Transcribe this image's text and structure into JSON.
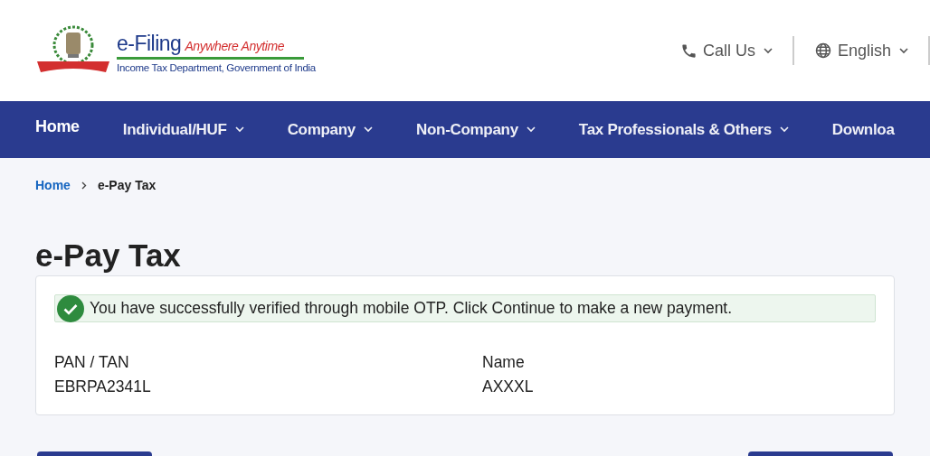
{
  "header": {
    "logo": {
      "brand": "e-Filing",
      "tagline": "Anywhere Anytime",
      "subtitle": "Income Tax Department, Government of India"
    },
    "actions": [
      {
        "kind": "phone",
        "label": "Call Us"
      },
      {
        "kind": "globe",
        "label": "English"
      }
    ]
  },
  "nav": [
    {
      "label": "Home",
      "selected": true,
      "dropdown": false
    },
    {
      "label": "Individual/HUF",
      "selected": false,
      "dropdown": true
    },
    {
      "label": "Company",
      "selected": false,
      "dropdown": true
    },
    {
      "label": "Non-Company",
      "selected": false,
      "dropdown": true
    },
    {
      "label": "Tax Professionals & Others",
      "selected": false,
      "dropdown": true
    },
    {
      "label": "Downloa",
      "selected": false,
      "dropdown": false
    }
  ],
  "breadcrumb": [
    {
      "label": "Home",
      "link": true
    },
    {
      "label": "e-Pay Tax",
      "link": false
    }
  ],
  "page_title": "e-Pay Tax",
  "alert": {
    "kind": "success",
    "message": "You have successfully verified through mobile OTP. Click Continue to make a new payment."
  },
  "fields": [
    {
      "label": "PAN / TAN",
      "value": "EBRPA2341L"
    },
    {
      "label": "Name",
      "value": "AXXXL"
    }
  ]
}
